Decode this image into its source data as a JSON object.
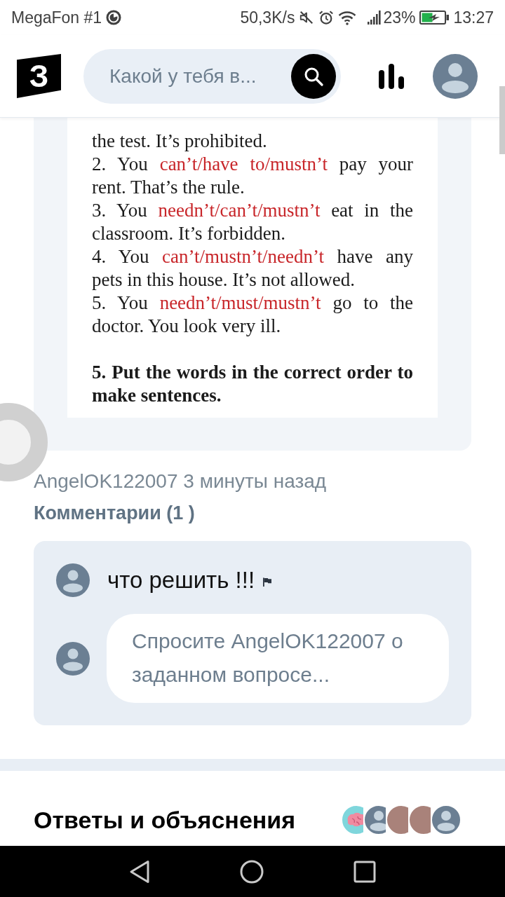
{
  "status_bar": {
    "carrier": "MegaFon #1",
    "speed": "50,3K/s",
    "battery": "23%",
    "time": "13:27"
  },
  "header": {
    "logo": "З",
    "search": {
      "placeholder": "Какой у тебя в..."
    }
  },
  "question": {
    "document": [
      {
        "kind": "item",
        "parts": [
          {
            "kind": "plain",
            "text": "the test. It’s prohibited."
          }
        ]
      },
      {
        "kind": "item",
        "parts": [
          {
            "kind": "plain",
            "text": "2. You "
          },
          {
            "kind": "choice",
            "text": "can’t/have to/mustn’t"
          },
          {
            "kind": "plain",
            "text": " pay your rent. That’s the rule."
          }
        ]
      },
      {
        "kind": "item",
        "parts": [
          {
            "kind": "plain",
            "text": "3. You "
          },
          {
            "kind": "choice",
            "text": "needn’t/can’t/mustn’t"
          },
          {
            "kind": "plain",
            "text": " eat in the classroom. It’s forbidden."
          }
        ]
      },
      {
        "kind": "item",
        "parts": [
          {
            "kind": "plain",
            "text": "4. You "
          },
          {
            "kind": "choice",
            "text": "can’t/mustn’t/needn’t"
          },
          {
            "kind": "plain",
            "text": " have any pets in this house. It’s not allowed."
          }
        ]
      },
      {
        "kind": "item",
        "parts": [
          {
            "kind": "plain",
            "text": "5. You "
          },
          {
            "kind": "choice",
            "text": "needn’t/must/mustn’t"
          },
          {
            "kind": "plain",
            "text": " go to the doctor. You look very ill."
          }
        ]
      },
      {
        "kind": "heading",
        "parts": [
          {
            "kind": "plain",
            "text": "5. Put the words in the correct order to make sentences."
          }
        ]
      }
    ],
    "meta": "AngelOK122007 3 минуты назад"
  },
  "comments": {
    "title": "Комментарии (1 )",
    "items": [
      {
        "text": "что решить !!!"
      }
    ],
    "input": {
      "placeholder": "Спросите AngelOK122007 о заданном вопросе..."
    }
  },
  "answers": {
    "title": "Ответы и объяснения",
    "avatars": [
      {
        "kind": "illustration"
      },
      {
        "kind": "default"
      },
      {
        "kind": "photo"
      },
      {
        "kind": "photo"
      },
      {
        "kind": "default"
      }
    ]
  }
}
